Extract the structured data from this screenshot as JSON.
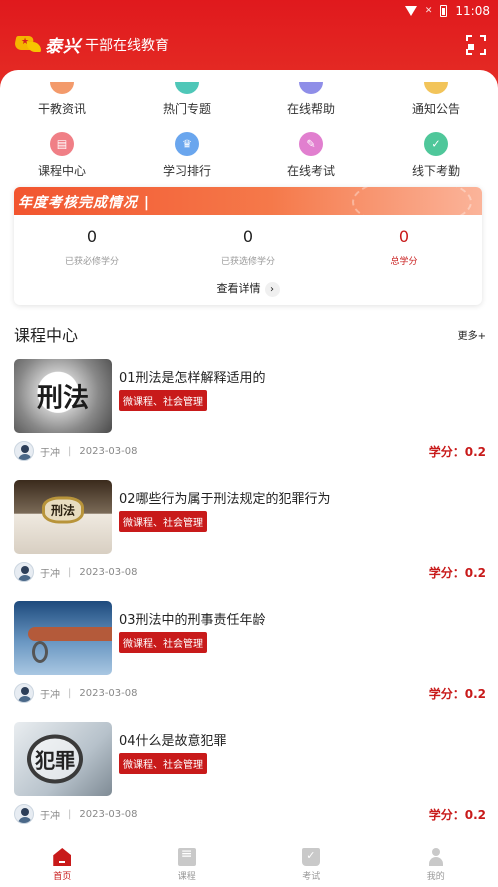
{
  "status_bar": {
    "time": "11:08"
  },
  "header": {
    "brand_name": "泰兴",
    "brand_sub": "干部在线教育"
  },
  "quick_menu": [
    {
      "label": "干教资讯",
      "icon": "news-icon",
      "color": "#f39a6b"
    },
    {
      "label": "热门专题",
      "icon": "topic-icon",
      "color": "#4fc7b8"
    },
    {
      "label": "在线帮助",
      "icon": "help-icon",
      "color": "#8f8ee8"
    },
    {
      "label": "通知公告",
      "icon": "notice-icon",
      "color": "#f2c45a"
    },
    {
      "label": "课程中心",
      "icon": "course-center-icon",
      "color": "#f07f86"
    },
    {
      "label": "学习排行",
      "icon": "ranking-icon",
      "color": "#6aa6ee"
    },
    {
      "label": "在线考试",
      "icon": "exam-icon",
      "color": "#e17fcf"
    },
    {
      "label": "线下考勤",
      "icon": "attendance-icon",
      "color": "#4fc79a"
    }
  ],
  "assessment": {
    "title": "年度考核完成情况",
    "stats": [
      {
        "value": "0",
        "label": "已获必修学分"
      },
      {
        "value": "0",
        "label": "已获选修学分"
      },
      {
        "value": "0",
        "label": "总学分"
      }
    ],
    "detail_label": "查看详情"
  },
  "course_center": {
    "title": "课程中心",
    "more_label": "更多+",
    "courses": [
      {
        "title": "01刑法是怎样解释适用的",
        "tag": "微课程、社会管理",
        "author": "于冲",
        "date": "2023-03-08",
        "credit": "学分：0.2",
        "thumb_text": "刑法"
      },
      {
        "title": "02哪些行为属于刑法规定的犯罪行为",
        "tag": "微课程、社会管理",
        "author": "于冲",
        "date": "2023-03-08",
        "credit": "学分：0.2",
        "thumb_text": "刑法"
      },
      {
        "title": "03刑法中的刑事责任年龄",
        "tag": "微课程、社会管理",
        "author": "于冲",
        "date": "2023-03-08",
        "credit": "学分：0.2",
        "thumb_text": ""
      },
      {
        "title": "04什么是故意犯罪",
        "tag": "微课程、社会管理",
        "author": "于冲",
        "date": "2023-03-08",
        "credit": "学分：0.2",
        "thumb_text": "犯罪"
      }
    ]
  },
  "tabbar": [
    {
      "label": "首页",
      "active": true
    },
    {
      "label": "课程",
      "active": false
    },
    {
      "label": "考试",
      "active": false
    },
    {
      "label": "我的",
      "active": false
    }
  ],
  "colors": {
    "primary": "#e0191d",
    "accent_red": "#c81a1a"
  }
}
